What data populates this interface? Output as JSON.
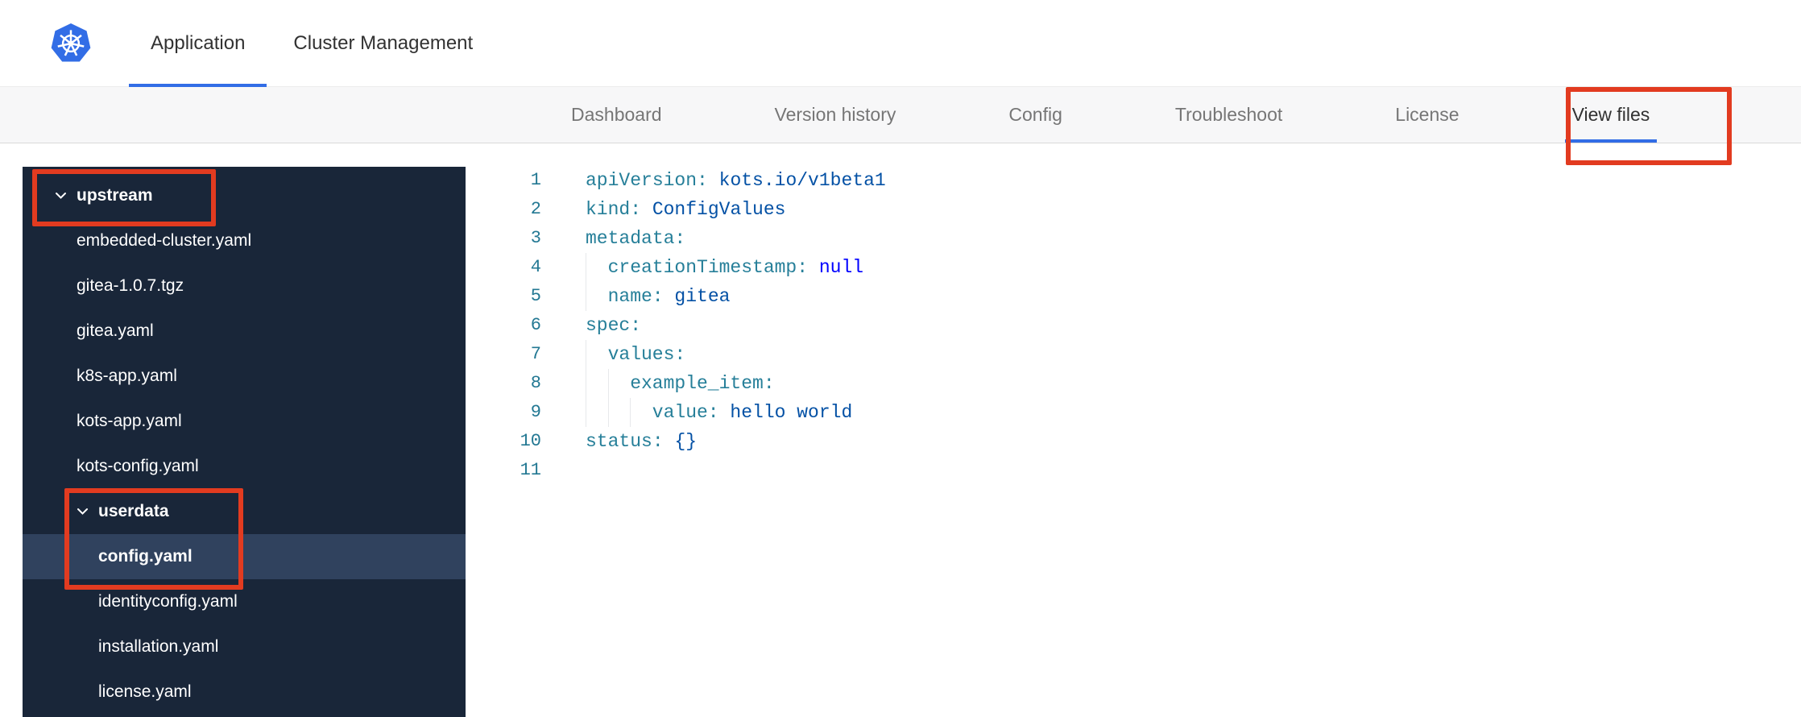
{
  "header": {
    "tabs": [
      {
        "label": "Application",
        "active": true
      },
      {
        "label": "Cluster Management",
        "active": false
      }
    ]
  },
  "subnav": {
    "tabs": [
      {
        "label": "Dashboard",
        "active": false
      },
      {
        "label": "Version history",
        "active": false
      },
      {
        "label": "Config",
        "active": false
      },
      {
        "label": "Troubleshoot",
        "active": false
      },
      {
        "label": "License",
        "active": false
      },
      {
        "label": "View files",
        "active": true,
        "annotated": true
      }
    ]
  },
  "file_tree": {
    "items": [
      {
        "type": "folder",
        "label": "upstream",
        "depth": 0,
        "expanded": true,
        "annotated": true
      },
      {
        "type": "file",
        "label": "embedded-cluster.yaml",
        "depth": 1
      },
      {
        "type": "file",
        "label": "gitea-1.0.7.tgz",
        "depth": 1
      },
      {
        "type": "file",
        "label": "gitea.yaml",
        "depth": 1
      },
      {
        "type": "file",
        "label": "k8s-app.yaml",
        "depth": 1
      },
      {
        "type": "file",
        "label": "kots-app.yaml",
        "depth": 1
      },
      {
        "type": "file",
        "label": "kots-config.yaml",
        "depth": 1
      },
      {
        "type": "folder",
        "label": "userdata",
        "depth": 1,
        "expanded": true,
        "annotated": true
      },
      {
        "type": "file",
        "label": "config.yaml",
        "depth": 2,
        "selected": true,
        "annotated": true
      },
      {
        "type": "file",
        "label": "identityconfig.yaml",
        "depth": 2
      },
      {
        "type": "file",
        "label": "installation.yaml",
        "depth": 2
      },
      {
        "type": "file",
        "label": "license.yaml",
        "depth": 2
      }
    ]
  },
  "editor": {
    "file_name": "config.yaml",
    "language": "yaml",
    "lines": [
      {
        "num": 1,
        "indent": 0,
        "tokens": [
          {
            "t": "apiVersion:",
            "c": "key"
          },
          {
            "t": " ",
            "c": "plain"
          },
          {
            "t": "kots.io/v1beta1",
            "c": "value"
          }
        ]
      },
      {
        "num": 2,
        "indent": 0,
        "tokens": [
          {
            "t": "kind:",
            "c": "key"
          },
          {
            "t": " ",
            "c": "plain"
          },
          {
            "t": "ConfigValues",
            "c": "value"
          }
        ]
      },
      {
        "num": 3,
        "indent": 0,
        "tokens": [
          {
            "t": "metadata:",
            "c": "key"
          }
        ]
      },
      {
        "num": 4,
        "indent": 2,
        "tokens": [
          {
            "t": "creationTimestamp:",
            "c": "key"
          },
          {
            "t": " ",
            "c": "plain"
          },
          {
            "t": "null",
            "c": "keyword"
          }
        ]
      },
      {
        "num": 5,
        "indent": 2,
        "tokens": [
          {
            "t": "name:",
            "c": "key"
          },
          {
            "t": " ",
            "c": "plain"
          },
          {
            "t": "gitea",
            "c": "value"
          }
        ]
      },
      {
        "num": 6,
        "indent": 0,
        "tokens": [
          {
            "t": "spec:",
            "c": "key"
          }
        ]
      },
      {
        "num": 7,
        "indent": 2,
        "tokens": [
          {
            "t": "values:",
            "c": "key"
          }
        ]
      },
      {
        "num": 8,
        "indent": 4,
        "tokens": [
          {
            "t": "example_item:",
            "c": "key"
          }
        ]
      },
      {
        "num": 9,
        "indent": 6,
        "tokens": [
          {
            "t": "value:",
            "c": "key"
          },
          {
            "t": " ",
            "c": "plain"
          },
          {
            "t": "hello world",
            "c": "value"
          }
        ]
      },
      {
        "num": 10,
        "indent": 0,
        "tokens": [
          {
            "t": "status:",
            "c": "key"
          },
          {
            "t": " ",
            "c": "plain"
          },
          {
            "t": "{}",
            "c": "value"
          }
        ]
      },
      {
        "num": 11,
        "indent": 0,
        "tokens": []
      }
    ]
  },
  "colors": {
    "accent": "#326de6",
    "sidebar_bg": "#192639",
    "sidebar_selected": "#30425e",
    "annotation": "#e23b20",
    "code_key": "#267f99",
    "code_value": "#0451a5",
    "code_keyword": "#0000ff",
    "line_number": "#237893"
  },
  "icons": {
    "logo": "kubernetes-helm-wheel",
    "folder_toggle": "chevron-down"
  }
}
